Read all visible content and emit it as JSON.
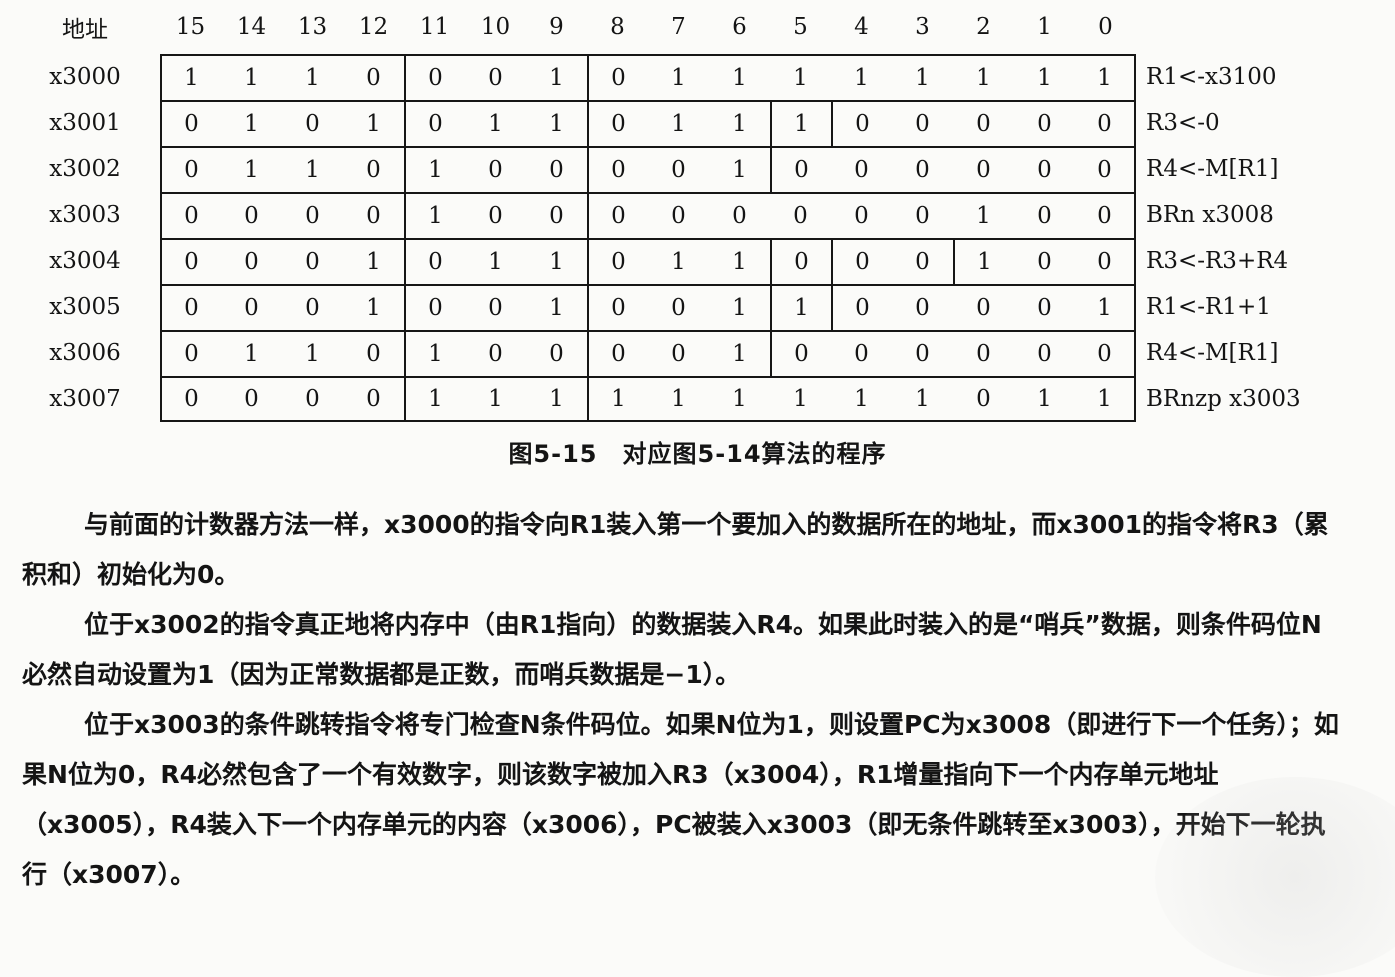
{
  "table": {
    "header": {
      "addr_label": "地址",
      "bits": [
        "15",
        "14",
        "13",
        "12",
        "11",
        "10",
        "9",
        "8",
        "7",
        "6",
        "5",
        "4",
        "3",
        "2",
        "1",
        "0"
      ]
    },
    "rows": [
      {
        "addr": "x3000",
        "bits": [
          "1",
          "1",
          "1",
          "0",
          "0",
          "0",
          "1",
          "0",
          "1",
          "1",
          "1",
          "1",
          "1",
          "1",
          "1",
          "1"
        ],
        "comment": "R1<-x3100"
      },
      {
        "addr": "x3001",
        "bits": [
          "0",
          "1",
          "0",
          "1",
          "0",
          "1",
          "1",
          "0",
          "1",
          "1",
          "1",
          "0",
          "0",
          "0",
          "0",
          "0"
        ],
        "comment": "R3<-0"
      },
      {
        "addr": "x3002",
        "bits": [
          "0",
          "1",
          "1",
          "0",
          "1",
          "0",
          "0",
          "0",
          "0",
          "1",
          "0",
          "0",
          "0",
          "0",
          "0",
          "0"
        ],
        "comment": "R4<-M[R1]"
      },
      {
        "addr": "x3003",
        "bits": [
          "0",
          "0",
          "0",
          "0",
          "1",
          "0",
          "0",
          "0",
          "0",
          "0",
          "0",
          "0",
          "0",
          "1",
          "0",
          "0"
        ],
        "comment": "BRn x3008"
      },
      {
        "addr": "x3004",
        "bits": [
          "0",
          "0",
          "0",
          "1",
          "0",
          "1",
          "1",
          "0",
          "1",
          "1",
          "0",
          "0",
          "0",
          "1",
          "0",
          "0"
        ],
        "comment": "R3<-R3+R4"
      },
      {
        "addr": "x3005",
        "bits": [
          "0",
          "0",
          "0",
          "1",
          "0",
          "0",
          "1",
          "0",
          "0",
          "1",
          "1",
          "0",
          "0",
          "0",
          "0",
          "1"
        ],
        "comment": "R1<-R1+1"
      },
      {
        "addr": "x3006",
        "bits": [
          "0",
          "1",
          "1",
          "0",
          "1",
          "0",
          "0",
          "0",
          "0",
          "1",
          "0",
          "0",
          "0",
          "0",
          "0",
          "0"
        ],
        "comment": "R4<-M[R1]"
      },
      {
        "addr": "x3007",
        "bits": [
          "0",
          "0",
          "0",
          "0",
          "1",
          "1",
          "1",
          "1",
          "1",
          "1",
          "1",
          "1",
          "1",
          "0",
          "1",
          "1"
        ],
        "comment": "BRnzp x3003"
      }
    ]
  },
  "caption": "图5-15　对应图5-14算法的程序",
  "paragraphs": [
    "与前面的计数器方法一样，x3000的指令向R1装入第一个要加入的数据所在的地址，而x3001的指令将R3（累积和）初始化为0。",
    "位于x3002的指令真正地将内存中（由R1指向）的数据装入R4。如果此时装入的是“哨兵”数据，则条件码位N必然自动设置为1（因为正常数据都是正数，而哨兵数据是−1）。",
    "位于x3003的条件跳转指令将专门检查N条件码位。如果N位为1，则设置PC为x3008（即进行下一个任务）；如果N位为0，R4必然包含了一个有效数字，则该数字被加入R3（x3004），R1增量指向下一个内存单元地址（x3005），R4装入下一个内存单元的内容（x3006），PC被装入x3003（即无条件跳转至x3003），开始下一轮执行（x3007）。"
  ]
}
